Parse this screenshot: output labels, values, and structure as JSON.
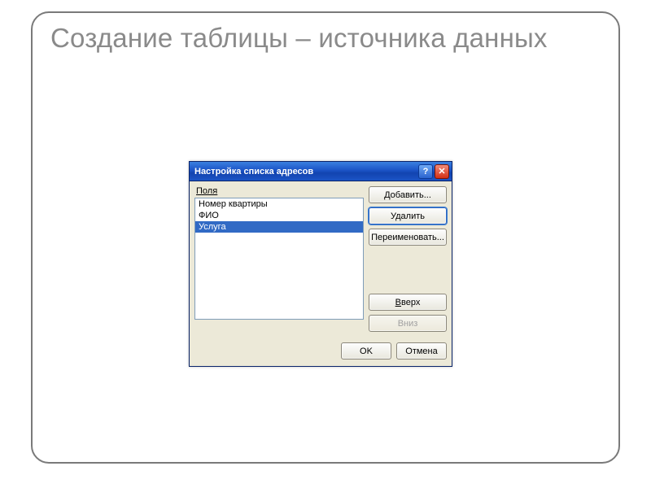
{
  "slide": {
    "title": "Создание таблицы – источника данных"
  },
  "dialog": {
    "title": "Настройка списка адресов",
    "fields_label": "Поля",
    "list": {
      "items": [
        "Номер квартиры",
        "ФИО",
        "Услуга"
      ],
      "selected_index": 2
    },
    "buttons": {
      "add": "Добавить...",
      "delete": "Удалить",
      "rename": "Переименовать...",
      "up": "Вверх",
      "down": "Вниз",
      "ok": "OK",
      "cancel": "Отмена"
    },
    "titlebar": {
      "help": "?",
      "close": "✕"
    }
  }
}
